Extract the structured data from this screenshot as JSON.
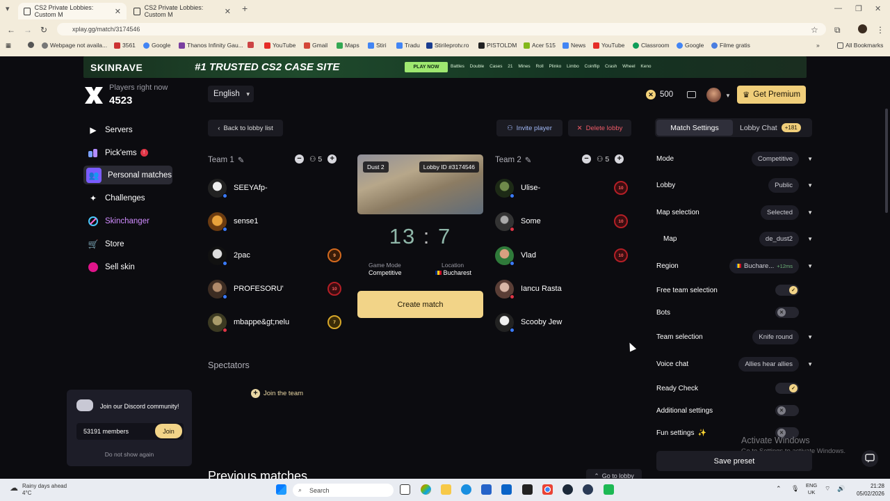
{
  "browser": {
    "tabs": [
      {
        "title": "CS2 Private Lobbies: Custom M",
        "active": true
      },
      {
        "title": "CS2 Private Lobbies: Custom M",
        "active": false
      }
    ],
    "url": "xplay.gg/match/3174546",
    "bookmarks": [
      "Webpage not availa...",
      "3561",
      "Google",
      "Thanos Infinity Gau...",
      "YouTube",
      "Gmail",
      "Maps",
      "Stiri",
      "Tradu",
      "Stirileprotv.ro",
      "PISTOLDM",
      "Acer 515",
      "News",
      "YouTube",
      "Classroom",
      "Google",
      "Filme gratis"
    ],
    "all_bookmarks": "All Bookmarks"
  },
  "banner": {
    "brand": "SKINRAVE",
    "slogan": "#1 TRUSTED CS2 CASE SITE",
    "play": "PLAY NOW",
    "games": "Battles Double Cases 21 Mines Roll Plinko Limbo Coinflip Crash Wheel Keno"
  },
  "header": {
    "players_label": "Players right now",
    "players_count": "4523",
    "language": "English",
    "coins": "500",
    "premium": "Get Premium"
  },
  "sidebar": {
    "items": [
      {
        "label": "Servers",
        "icon": "play-icon"
      },
      {
        "label": "Pick'ems",
        "icon": "pickems-icon",
        "badge": "!"
      },
      {
        "label": "Personal matches",
        "icon": "users-icon",
        "active": true
      },
      {
        "label": "Challenges",
        "icon": "puzzle-icon"
      },
      {
        "label": "Skinchanger",
        "icon": "skinchanger-icon"
      },
      {
        "label": "Store",
        "icon": "cart-icon"
      },
      {
        "label": "Sell skin",
        "icon": "sell-icon"
      }
    ]
  },
  "lobby": {
    "back": "Back to lobby list",
    "invite": "Invite player",
    "delete": "Delete lobby",
    "team1": {
      "name": "Team 1",
      "count": "5",
      "players": [
        {
          "name": "SEEYAfp-",
          "rank": ""
        },
        {
          "name": "sense1",
          "rank": ""
        },
        {
          "name": "2pac",
          "rank": "9"
        },
        {
          "name": "PROFESORU'",
          "rank": "10"
        },
        {
          "name": "mbappe&gt;nelu",
          "rank": "7"
        }
      ]
    },
    "team2": {
      "name": "Team 2",
      "count": "5",
      "players": [
        {
          "name": "Ulise-",
          "rank": "10"
        },
        {
          "name": "Some",
          "rank": "10"
        },
        {
          "name": "Vlad",
          "rank": "10"
        },
        {
          "name": "Iancu Rasta",
          "rank": ""
        },
        {
          "name": "Scooby Jew",
          "rank": ""
        }
      ]
    },
    "map_name": "Dust 2",
    "lobby_id": "Lobby ID #3174546",
    "score_left": "13",
    "score_right": "7",
    "game_mode_label": "Game Mode",
    "game_mode": "Competitive",
    "location_label": "Location",
    "location": "Bucharest",
    "create": "Create match",
    "spectators": "Spectators",
    "join_team": "Join the team",
    "previous": "Previous matches",
    "go_lobby": "Go to lobby"
  },
  "discord": {
    "title": "Join our Discord community!",
    "members": "53191 members",
    "join": "Join",
    "dismiss": "Do not show again"
  },
  "settings": {
    "tab_match": "Match Settings",
    "tab_chat": "Lobby Chat",
    "chat_count": "+181",
    "rows": [
      {
        "label": "Mode",
        "value": "Competitive",
        "kind": "select"
      },
      {
        "label": "Lobby",
        "value": "Public",
        "kind": "select"
      },
      {
        "label": "Map selection",
        "value": "Selected",
        "kind": "select"
      },
      {
        "label": "Map",
        "value": "de_dust2",
        "kind": "select"
      },
      {
        "label": "Region",
        "value": "Buchare...",
        "extra": "+12ms",
        "kind": "select"
      },
      {
        "label": "Free team selection",
        "kind": "toggle",
        "on": true
      },
      {
        "label": "Bots",
        "kind": "toggle",
        "on": false
      },
      {
        "label": "Team selection",
        "value": "Knife round",
        "kind": "select"
      },
      {
        "label": "Voice chat",
        "value": "Allies hear allies",
        "kind": "select"
      },
      {
        "label": "Ready Check",
        "kind": "toggle",
        "on": true
      },
      {
        "label": "Additional settings",
        "kind": "toggle",
        "on": false
      },
      {
        "label": "Fun settings",
        "kind": "toggle",
        "on": false
      }
    ],
    "save": "Save preset"
  },
  "windows": {
    "activate": "Activate Windows",
    "activate_sub": "Go to Settings to activate Windows."
  },
  "taskbar": {
    "weather_line1": "Rainy days ahead",
    "weather_line2": "4°C",
    "search": "Search",
    "lang1": "ENG",
    "lang2": "UK",
    "time": "21:28",
    "date": "05/02/2026"
  },
  "colors": {
    "accent": "#f2d488",
    "danger": "#ef5b67",
    "invite": "#9fb7f5"
  }
}
